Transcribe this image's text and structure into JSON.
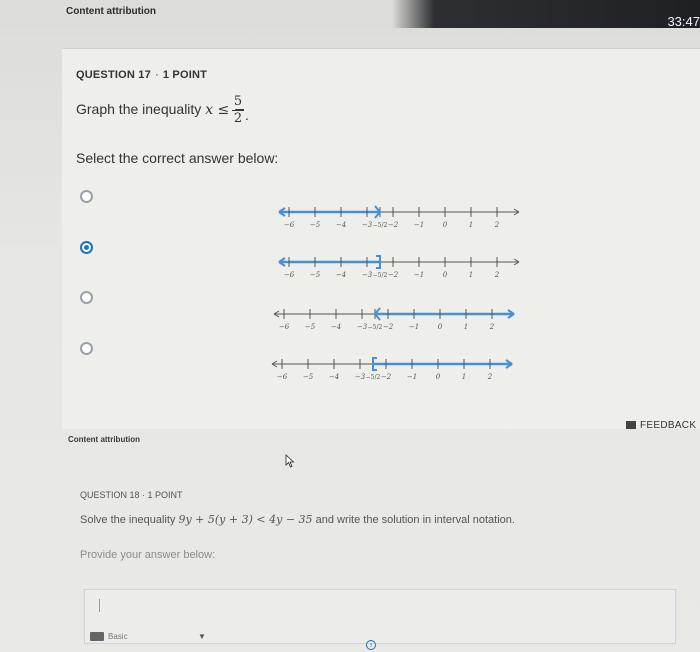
{
  "topbar": {
    "label": "Content attribution",
    "timer": "33:47"
  },
  "question17": {
    "number": "QUESTION 17",
    "separator": "·",
    "points": "1 POINT",
    "prompt_text": "Graph the inequality",
    "prompt_math": "x ≤ −",
    "fraction": {
      "numerator": "5",
      "denominator": "2"
    },
    "prompt_end": ".",
    "select_label": "Select the correct answer below:",
    "options": [
      {
        "selected": false,
        "ticks": [
          "−6",
          "−5",
          "−4",
          "−3",
          "−2",
          "−1",
          "0",
          "1",
          "2"
        ],
        "fraction_tick": "−5/2"
      },
      {
        "selected": true,
        "ticks": [
          "−6",
          "−5",
          "−4",
          "−3",
          "−2",
          "−1",
          "0",
          "1",
          "2"
        ],
        "fraction_tick": "−5/2"
      },
      {
        "selected": false,
        "ticks": [
          "−6",
          "−5",
          "−4",
          "−3",
          "−2",
          "−1",
          "0",
          "1",
          "2"
        ],
        "fraction_tick": "−5/2"
      },
      {
        "selected": false,
        "ticks": [
          "−6",
          "−5",
          "−4",
          "−3",
          "−2",
          "−1",
          "0",
          "1",
          "2"
        ],
        "fraction_tick": "−5/2"
      }
    ]
  },
  "feedback": {
    "label": "FEEDBACK"
  },
  "attribution2": "Content attribution",
  "question18": {
    "number": "QUESTION 18",
    "separator": "·",
    "points": "1 POINT",
    "prompt_text": "Solve the inequality",
    "prompt_math": "9y + 5(y + 3) < 4y − 35",
    "prompt_end": "and write the solution in interval notation.",
    "provide_label": "Provide your answer below:",
    "keyboard_label": "Basic"
  },
  "colors": {
    "accent": "#1a73c6",
    "line": "#4a8fd0"
  }
}
